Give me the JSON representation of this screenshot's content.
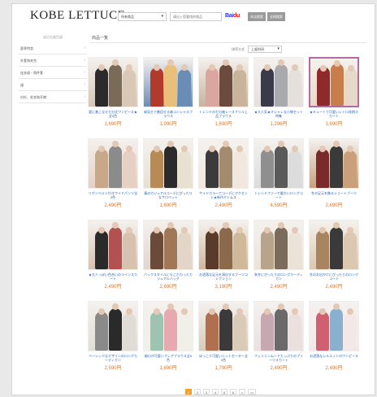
{
  "header": {
    "logo": "KOBE LETTUCE",
    "search_category": "所有商品",
    "search_placeholder": "请出入您要找的商品",
    "baidu_part1": "Bai",
    "baidu_part2": "du",
    "button_search_site": "本店搜索",
    "button_search_all": "全网搜索"
  },
  "sidebar": {
    "title": "宝贝分类目录",
    "items": [
      {
        "label": "夏季特卖"
      },
      {
        "label": "外套和夹克"
      },
      {
        "label": "连衣裙・两件套"
      },
      {
        "label": "裙"
      },
      {
        "label": "衬衫、毛衣和开襟"
      }
    ]
  },
  "main": {
    "title": "商品一覧",
    "sort_label": "排序方式",
    "sort_value": "上架时间"
  },
  "products": [
    {
      "desc": "夏に着こなせ七分丈ワンピース★全4色",
      "price": "1,690円",
      "colors": [
        "#2b2b2b",
        "#7a6a58",
        "#d8c8b5"
      ]
    },
    {
      "desc": "肩見せで着回せる袖コンシャスブラウス",
      "price": "1,990円",
      "colors": [
        "#b23a2c",
        "#e8c07a",
        "#6a8db5"
      ]
    },
    {
      "desc": "トレンドの七分袖レースフリル上品ブラウス",
      "price": "1,690円",
      "colors": [
        "#d9a7a0",
        "#6b4b3e",
        "#c9b39b"
      ]
    },
    {
      "desc": "★大人気★オシャレな小物セット特集",
      "price": "1,296円",
      "colors": [
        "#3a3a4a",
        "#a9a9b0",
        "#e5e0dc"
      ]
    },
    {
      "desc": "★キュートで可愛いレトロ花柄スカート",
      "price": "1,690円",
      "colors": [
        "#8e2a2a",
        "#c77e4a",
        "#e7d9c8"
      ]
    },
    {
      "desc": "リボンベルト付きワイドパンツ全3色",
      "price": "2,490円",
      "colors": [
        "#c9a88a",
        "#8b8b8b",
        "#e6d0c3"
      ]
    },
    {
      "desc": "春のカジュアルコーデにぴったりなサロペット",
      "price": "1,690円",
      "colors": [
        "#b88a55",
        "#2b2b2b",
        "#e8e0d0"
      ]
    },
    {
      "desc": "サイドカラーでコーデにアクセント★新作ボトムス",
      "price": "2,490円",
      "colors": [
        "#3b3b3b",
        "#a38b6e",
        "#f0e8de"
      ]
    },
    {
      "desc": "トレンドファーで暖かいロングコート",
      "price": "4,590円",
      "colors": [
        "#8f8f8f",
        "#5a5a5a",
        "#dcdcdc"
      ]
    },
    {
      "desc": "冬の足元を飾るショートブーツ",
      "price": "2,690円",
      "colors": [
        "#7a2a2a",
        "#3a3a3a",
        "#c9a07a"
      ]
    },
    {
      "desc": "★大人っぽい色合いのラインスカート",
      "price": "2,490円",
      "colors": [
        "#2a2a2a",
        "#b35050",
        "#d7c2b0"
      ]
    },
    {
      "desc": "バックスタイルにもこだわったカジュアルバッグ",
      "price": "2,690円",
      "colors": [
        "#6b4a3a",
        "#a07858",
        "#e3d5c8"
      ]
    },
    {
      "desc": "お洒落な足元を演出するブーツコレクション",
      "price": "3,190円",
      "colors": [
        "#5a3a2a",
        "#8a6a4a",
        "#d0b89a"
      ]
    },
    {
      "desc": "秋冬にぴったりのロングカーディガン",
      "price": "2,490円",
      "colors": [
        "#b8a48a",
        "#7b6b5a",
        "#ece3d8"
      ]
    },
    {
      "desc": "冬のお出かけにぴったりのロングコート",
      "price": "2,490円",
      "colors": [
        "#a88560",
        "#3a3a3a",
        "#dcc8b0"
      ]
    },
    {
      "desc": "ベーシックなデザインのロングカーディガン",
      "price": "2,590円",
      "colors": [
        "#8a8a8a",
        "#2a2a2a",
        "#e0dcd6"
      ]
    },
    {
      "desc": "袖口が可愛いフレアブラウス全5色",
      "price": "1,890円",
      "colors": [
        "#9cc4b0",
        "#e8a8b0",
        "#f0efe8"
      ]
    },
    {
      "desc": "ほっこり可愛いニットセーター全3色",
      "price": "1,790円",
      "colors": [
        "#b07050",
        "#3a3a3a",
        "#d9cbb8"
      ]
    },
    {
      "desc": "フェミニンムードたっぷりのプリーツスカート",
      "price": "2,490円",
      "colors": [
        "#c8a8b0",
        "#6a6a6a",
        "#ebe0e0"
      ]
    },
    {
      "desc": "お洒落なシルエットのワンピース",
      "price": "2,490円",
      "colors": [
        "#d06070",
        "#8ab0d0",
        "#f3e8e8"
      ]
    }
  ],
  "pagination": {
    "pages": [
      "1",
      "2",
      "3",
      "4",
      "5",
      "6",
      ">",
      ">>"
    ],
    "current": "1"
  }
}
